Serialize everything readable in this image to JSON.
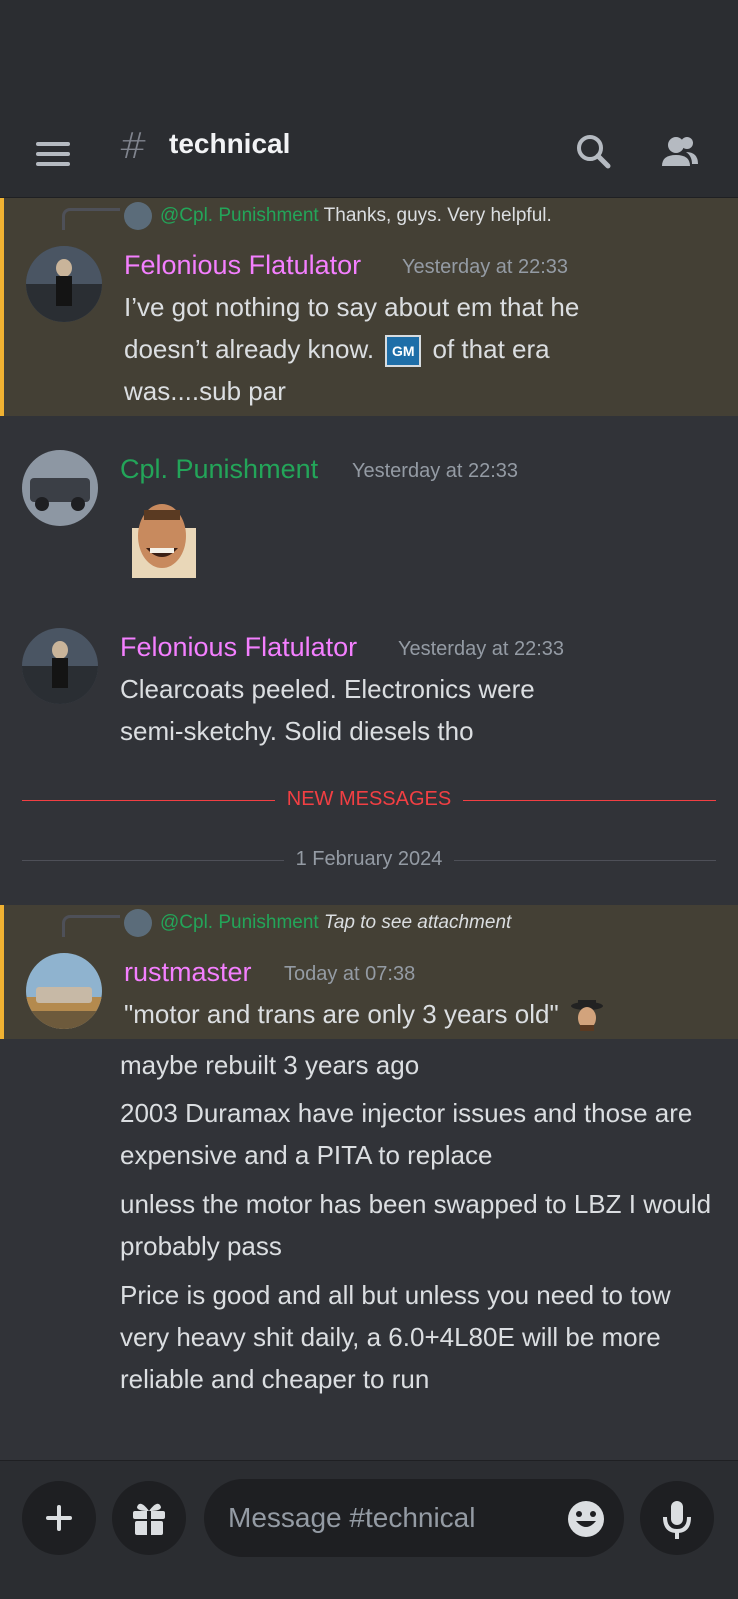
{
  "header": {
    "hash": "#",
    "channel": "technical"
  },
  "messages": [
    {
      "reply": {
        "mention": "@Cpl. Punishment",
        "text": "Thanks, guys. Very helpful."
      },
      "author": "Felonious Flatulator",
      "timestamp": "Yesterday at 22:33",
      "lines": [
        "I’ve got nothing to say about em that he",
        "doesn’t already know.",
        "of that era",
        "was....sub par"
      ],
      "inline_emoji": "GM"
    },
    {
      "author": "Cpl. Punishment",
      "timestamp": "Yesterday at 22:33",
      "sticker": "laughing-man-emoji"
    },
    {
      "author": "Felonious Flatulator",
      "timestamp": "Yesterday at 22:33",
      "lines": [
        "Clearcoats peeled. Electronics were",
        "semi-sketchy. Solid diesels tho"
      ]
    },
    {
      "reply": {
        "mention": "@Cpl. Punishment",
        "text": "Tap to see attachment"
      },
      "author": "rustmaster",
      "timestamp": "Today at 07:38",
      "first_line": "\"motor and trans are only 3 years old\"",
      "followups": [
        "maybe rebuilt 3 years ago",
        "2003 Duramax have injector issues and those are expensive and a PITA to replace",
        "unless the motor has been swapped to LBZ I would probably pass",
        "Price is good and all but unless you need to tow very heavy shit daily, a 6.0+4L80E will be more reliable and cheaper to run"
      ]
    }
  ],
  "dividers": {
    "new_messages": "NEW MESSAGES",
    "date": "1 February 2024"
  },
  "composer": {
    "placeholder": "Message #technical"
  },
  "colors": {
    "felonious": "#f47fff",
    "cpl": "#23a559",
    "rustmaster": "#f47fff",
    "new_messages": "#f23f43",
    "highlight_bar": "#f0b232"
  }
}
